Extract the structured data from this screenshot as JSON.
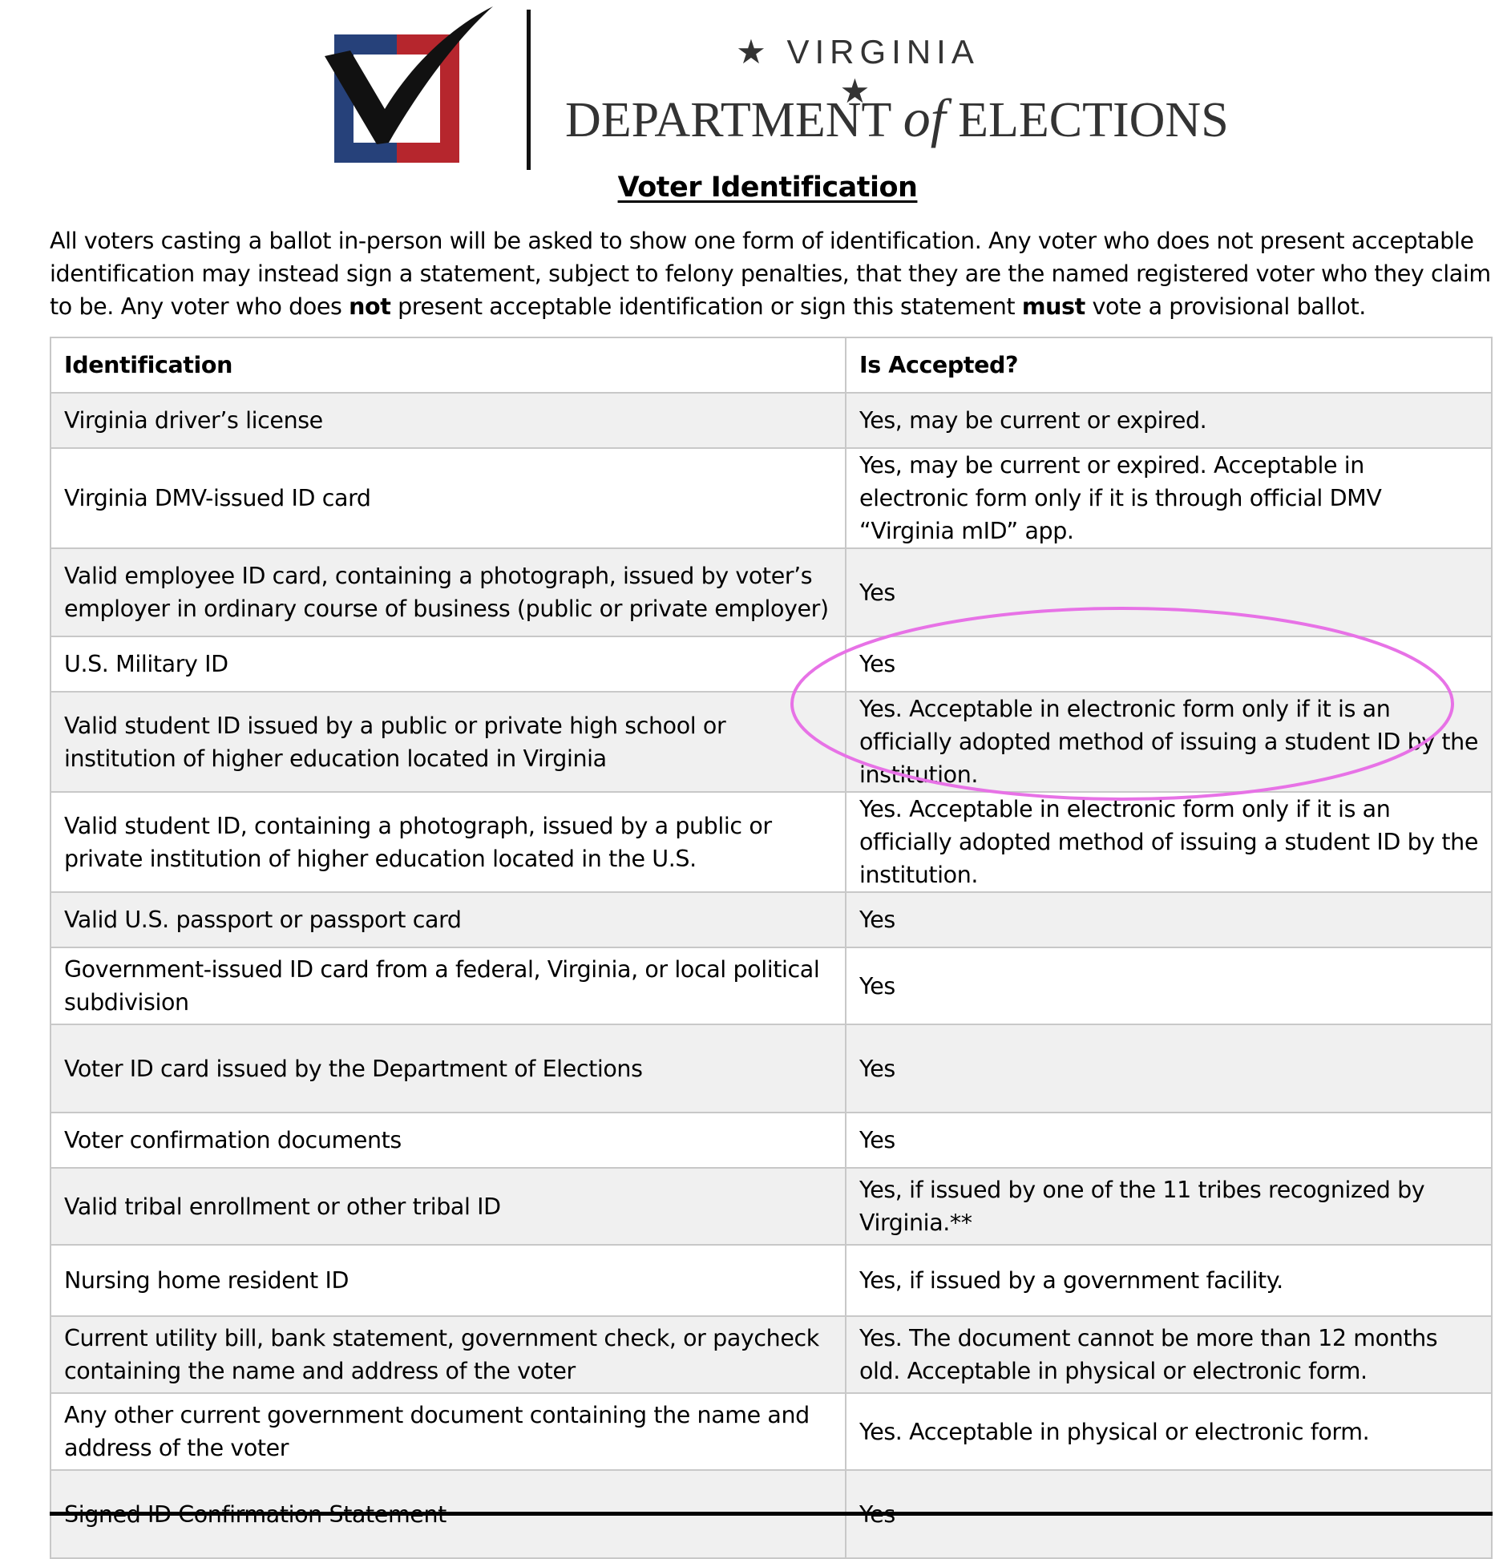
{
  "header": {
    "logo_state_text": "★ VIRGINIA ★",
    "logo_dept_text_1": "DEPARTMENT",
    "logo_dept_text_of": "of",
    "logo_dept_text_2": "ELECTIONS",
    "logo_colors": {
      "blue": "#26417a",
      "red": "#b6262d",
      "check": "#111111"
    }
  },
  "document": {
    "title": "Voter Identification",
    "intro_part1": "All voters casting a ballot in-person will be asked to show one form of identification. Any voter who does not present acceptable identification may instead sign a statement, subject to felony penalties, that they are the named registered voter who they claim to be. Any voter who does ",
    "intro_bold1": "not",
    "intro_part2": " present acceptable identification or sign this statement ",
    "intro_bold2": "must",
    "intro_part3": " vote a provisional ballot."
  },
  "table": {
    "headers": [
      "Identification",
      "Is Accepted?"
    ],
    "rows": [
      [
        "Virginia driver’s license",
        "Yes, may be current or expired."
      ],
      [
        "Virginia DMV-issued ID card",
        "Yes, may be current or expired. Acceptable in electronic form only if it is through official DMV “Virginia mID” app."
      ],
      [
        "Valid employee ID card, containing a photograph,  issued by voter’s employer in ordinary course of business (public or private employer)",
        "Yes"
      ],
      [
        "U.S. Military ID",
        "Yes"
      ],
      [
        "Valid student ID issued by a public or private high school or institution of higher education located in Virginia",
        "Yes. Acceptable in electronic form only if it is an officially adopted method of issuing a student ID by the institution."
      ],
      [
        "Valid student ID, containing a photograph, issued by a public or private institution of higher education located in the U.S.",
        "Yes. Acceptable in electronic form only if it is an officially adopted method of issuing a student ID by the institution."
      ],
      [
        "Valid U.S. passport or passport card",
        "Yes"
      ],
      [
        "Government-issued ID card from a federal, Virginia, or local political subdivision",
        "Yes"
      ],
      [
        "Voter ID card issued by the Department of Elections",
        "Yes"
      ],
      [
        "Voter confirmation documents",
        "Yes"
      ],
      [
        "Valid tribal enrollment or other tribal ID",
        "Yes, if issued by one of the 11 tribes recognized by Virginia.**"
      ],
      [
        "Nursing home resident ID",
        "Yes, if issued by a government facility."
      ],
      [
        "Current utility bill, bank statement, government check, or paycheck containing the name and address of the voter",
        "Yes. The document cannot be more than 12 months old. Acceptable in physical or electronic form."
      ],
      [
        "Any other current government document containing the name and address of the voter",
        "Yes. Acceptable in physical or electronic form."
      ],
      [
        "Signed ID Confirmation Statement",
        "Yes"
      ]
    ]
  },
  "annotation": {
    "ellipse_color": "#e772e6"
  }
}
